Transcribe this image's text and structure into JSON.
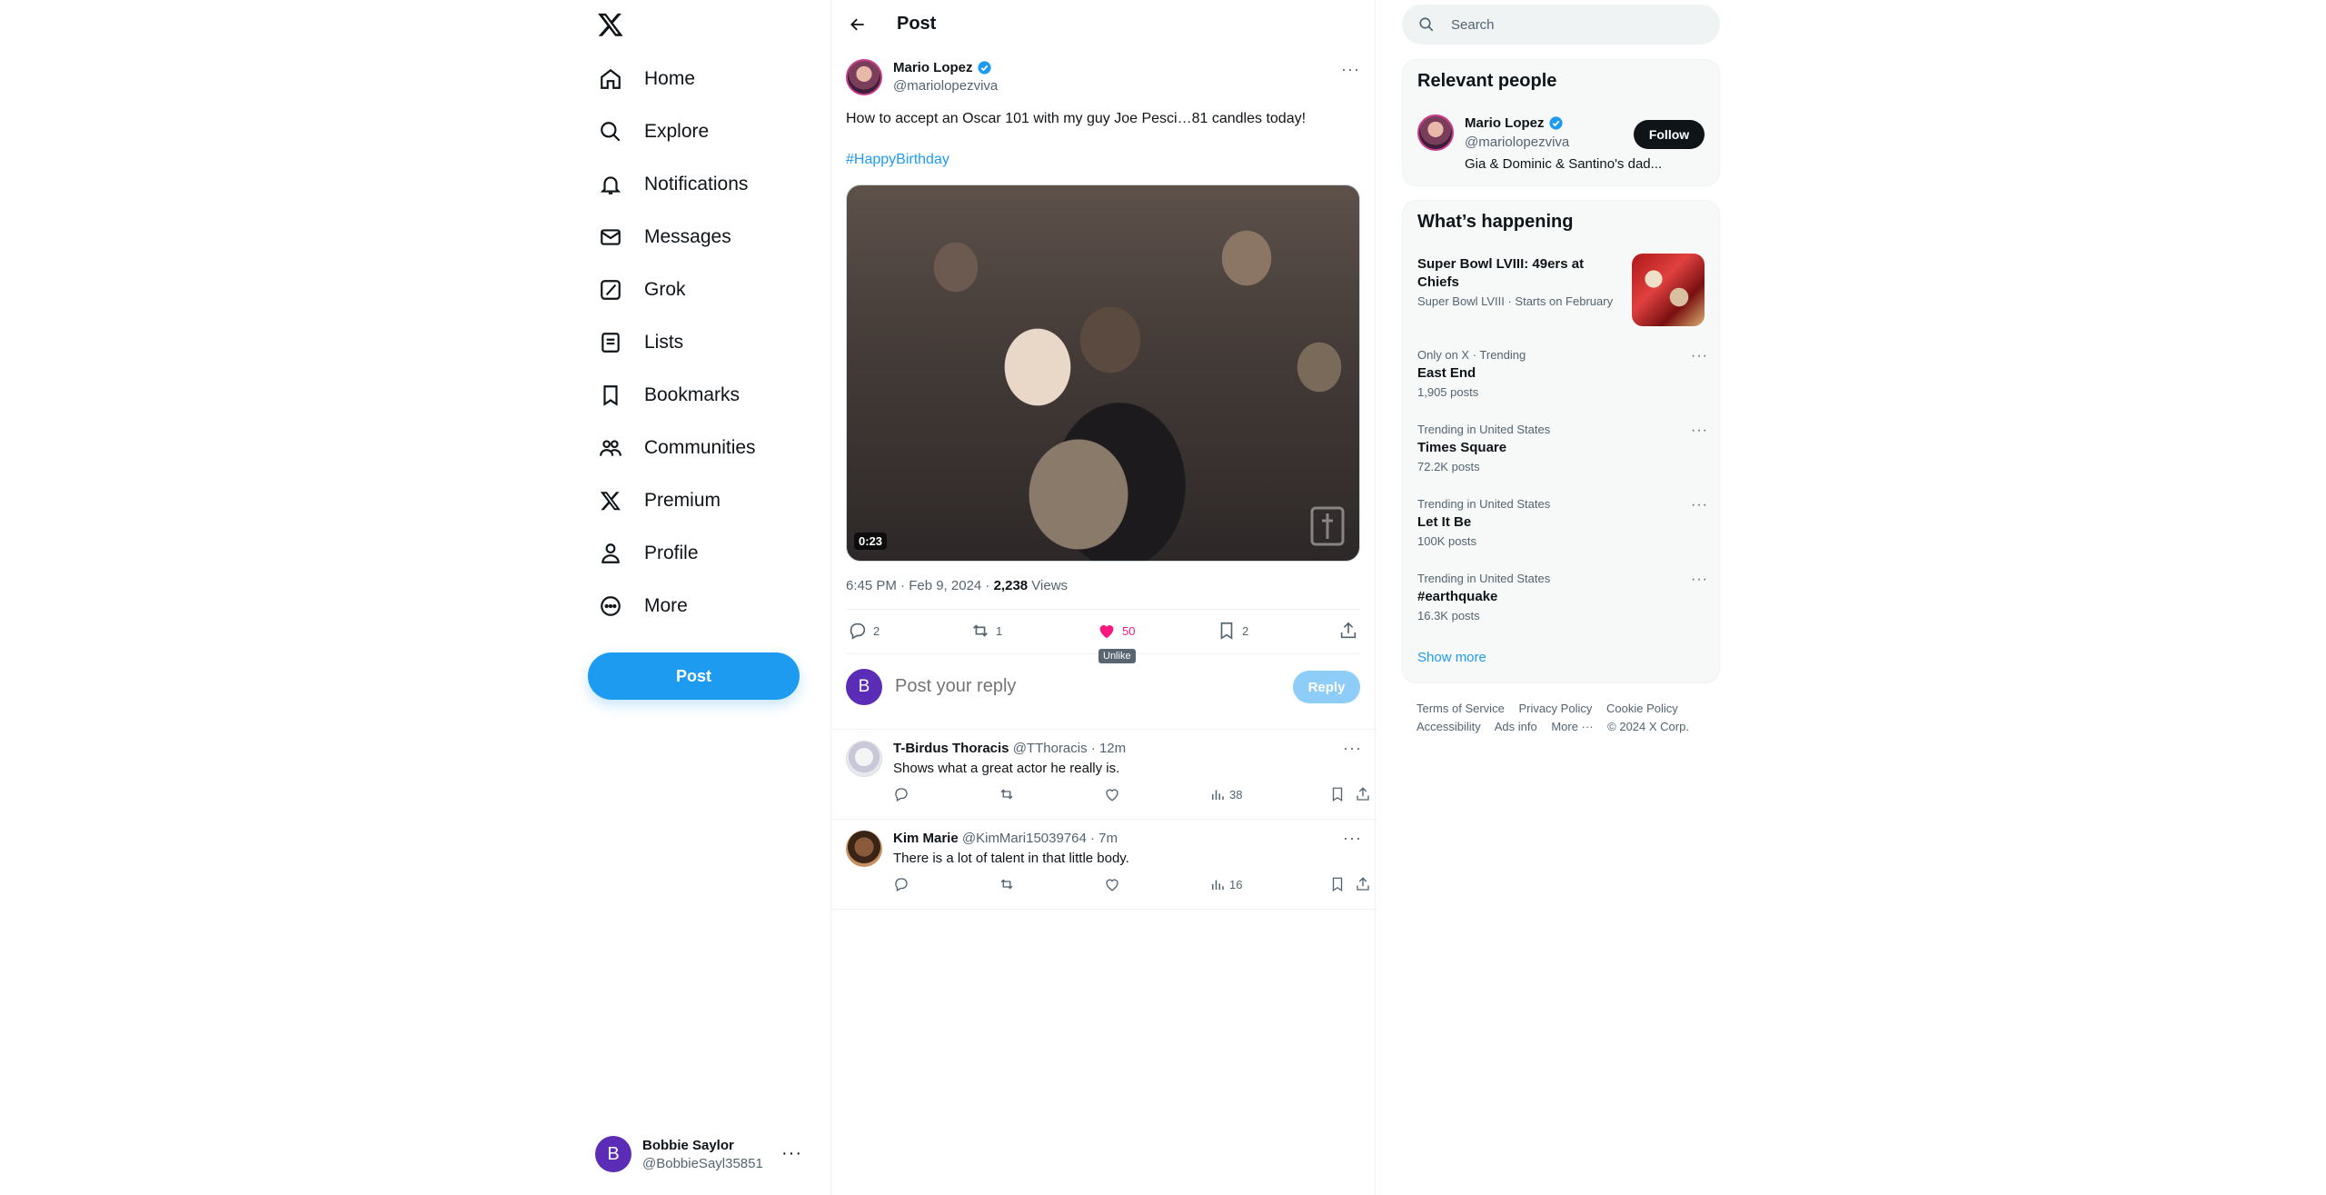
{
  "nav": {
    "items": [
      {
        "label": "Home",
        "icon": "home-icon"
      },
      {
        "label": "Explore",
        "icon": "search-icon"
      },
      {
        "label": "Notifications",
        "icon": "bell-icon"
      },
      {
        "label": "Messages",
        "icon": "mail-icon"
      },
      {
        "label": "Grok",
        "icon": "grok-icon"
      },
      {
        "label": "Lists",
        "icon": "list-icon"
      },
      {
        "label": "Bookmarks",
        "icon": "bookmark-icon"
      },
      {
        "label": "Communities",
        "icon": "people-icon"
      },
      {
        "label": "Premium",
        "icon": "x-logo-icon"
      },
      {
        "label": "Profile",
        "icon": "person-icon"
      },
      {
        "label": "More",
        "icon": "more-circle-icon"
      }
    ],
    "post_button": "Post",
    "account": {
      "initial": "B",
      "name": "Bobbie Saylor",
      "handle": "@BobbieSayl35851"
    }
  },
  "main": {
    "header_title": "Post",
    "post": {
      "author_name": "Mario Lopez",
      "author_handle": "@mariolopezviva",
      "text": "How to accept an Oscar 101 with my guy Joe Pesci…81 candles today!",
      "hashtag": "#HappyBirthday",
      "video_duration": "0:23",
      "timestamp": "6:45 PM · Feb 9, 2024 · ",
      "views_count": "2,238",
      "views_label": " Views",
      "stats": {
        "replies": "2",
        "reposts": "1",
        "likes": "50",
        "bookmarks": "2"
      },
      "like_tooltip": "Unlike"
    },
    "reply_composer": {
      "initial": "B",
      "placeholder": "Post your reply",
      "button": "Reply"
    },
    "replies": [
      {
        "name": "T-Birdus Thoracis",
        "handle": "@TThoracis · 12m",
        "text": "Shows what a great actor he really is.",
        "views": "38"
      },
      {
        "name": "Kim Marie",
        "handle": "@KimMari15039764 · 7m",
        "text": "There is a lot of talent in that little body.",
        "views": "16"
      }
    ]
  },
  "sidebar": {
    "search_placeholder": "Search",
    "relevant": {
      "title": "Relevant people",
      "name": "Mario Lopez",
      "handle": "@mariolopezviva",
      "bio": "Gia & Dominic & Santino's dad...",
      "follow": "Follow"
    },
    "happening": {
      "title": "What’s happening",
      "featured": {
        "title": "Super Bowl LVIII: 49ers at Chiefs",
        "context": "Super Bowl LVIII · Starts on February"
      },
      "trends": [
        {
          "context": "Only on X · Trending",
          "title": "East End",
          "count": "1,905 posts"
        },
        {
          "context": "Trending in United States",
          "title": "Times Square",
          "count": "72.2K posts"
        },
        {
          "context": "Trending in United States",
          "title": "Let It Be",
          "count": "100K posts"
        },
        {
          "context": "Trending in United States",
          "title": "#earthquake",
          "count": "16.3K posts"
        }
      ],
      "show_more": "Show more"
    },
    "footer": {
      "links": [
        "Terms of Service",
        "Privacy Policy",
        "Cookie Policy",
        "Accessibility",
        "Ads info",
        "More ···",
        "© 2024 X Corp."
      ]
    }
  },
  "colors": {
    "accent": "#1d9bf0",
    "like": "#f91880",
    "text": "#0f1419",
    "muted": "#536471"
  }
}
